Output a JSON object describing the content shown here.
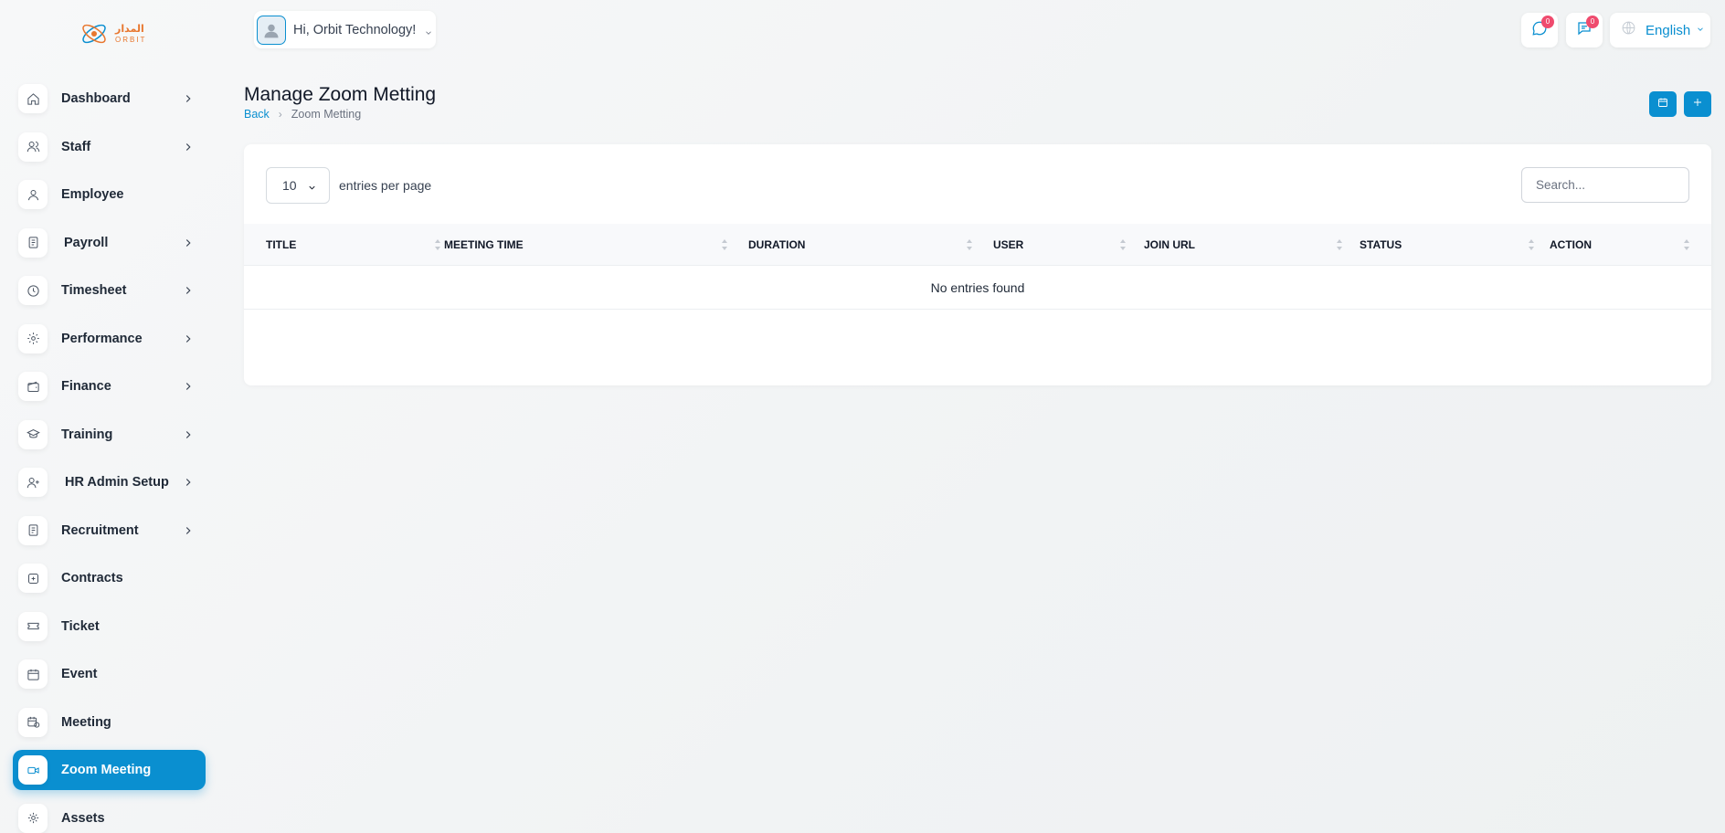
{
  "brand": {
    "arabic": "المدار",
    "latin": "ORBIT"
  },
  "header": {
    "greeting": "Hi, Orbit Technology!",
    "messages_badge": "0",
    "chat_badge": "0",
    "language": "English"
  },
  "sidebar": {
    "items": [
      {
        "label": "Dashboard",
        "icon": "home-icon",
        "has_children": true
      },
      {
        "label": "Staff",
        "icon": "users-icon",
        "has_children": true
      },
      {
        "label": "Employee",
        "icon": "user-icon",
        "has_children": false
      },
      {
        "label": "Payroll",
        "icon": "receipt-icon",
        "has_children": true
      },
      {
        "label": "Timesheet",
        "icon": "clock-icon",
        "has_children": true
      },
      {
        "label": "Performance",
        "icon": "performance-icon",
        "has_children": true
      },
      {
        "label": "Finance",
        "icon": "wallet-icon",
        "has_children": true
      },
      {
        "label": "Training",
        "icon": "graduation-cap-icon",
        "has_children": true
      },
      {
        "label": "HR Admin Setup",
        "icon": "user-plus-icon",
        "has_children": true
      },
      {
        "label": "Recruitment",
        "icon": "clipboard-icon",
        "has_children": true
      },
      {
        "label": "Contracts",
        "icon": "contract-icon",
        "has_children": false
      },
      {
        "label": "Ticket",
        "icon": "ticket-icon",
        "has_children": false
      },
      {
        "label": "Event",
        "icon": "calendar-icon",
        "has_children": false
      },
      {
        "label": "Meeting",
        "icon": "calendar-clock-icon",
        "has_children": false
      },
      {
        "label": "Zoom Meeting",
        "icon": "video-icon",
        "has_children": false,
        "active": true
      },
      {
        "label": "Assets",
        "icon": "assets-icon",
        "has_children": false
      }
    ]
  },
  "page": {
    "title": "Manage Zoom Metting",
    "breadcrumb_back": "Back",
    "breadcrumb_current": "Zoom Metting"
  },
  "table": {
    "per_page_value": "10",
    "per_page_label": "entries per page",
    "search_placeholder": "Search...",
    "columns": [
      "TITLE",
      "MEETING TIME",
      "DURATION",
      "USER",
      "JOIN URL",
      "STATUS",
      "ACTION"
    ],
    "empty_text": "No entries found"
  },
  "colors": {
    "accent": "#0a8fd0",
    "badge": "#ef4b6e",
    "brand_orange": "#e8772e"
  }
}
